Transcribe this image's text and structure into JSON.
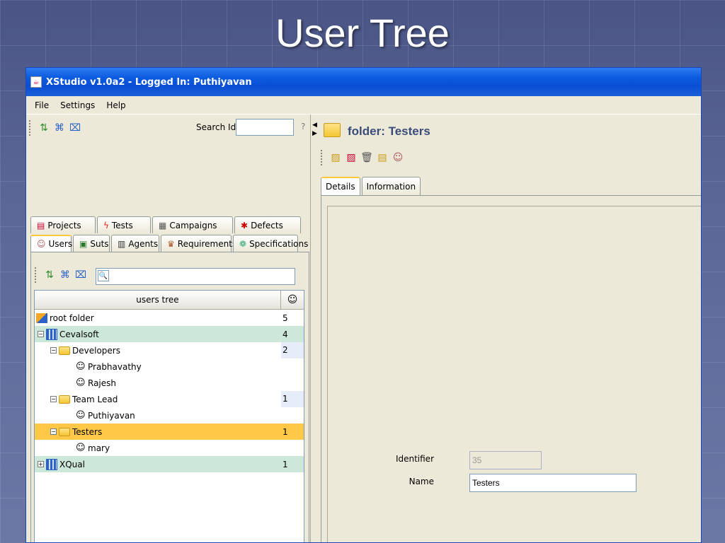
{
  "slide_title": "User Tree",
  "window": {
    "title": "XStudio v1.0a2 - Logged In: Puthiyavan"
  },
  "menu": [
    "File",
    "Settings",
    "Help"
  ],
  "search": {
    "label": "Search Id:",
    "value": "",
    "help": "?"
  },
  "tabs_row1": [
    {
      "label": "Projects",
      "icon": "projects-icon"
    },
    {
      "label": "Tests",
      "icon": "tests-icon"
    },
    {
      "label": "Campaigns",
      "icon": "campaigns-icon"
    },
    {
      "label": "Defects",
      "icon": "defects-icon"
    }
  ],
  "tabs_row2": [
    {
      "label": "Users",
      "icon": "users-icon",
      "active": true
    },
    {
      "label": "Suts",
      "icon": "suts-icon"
    },
    {
      "label": "Agents",
      "icon": "agents-icon"
    },
    {
      "label": "Requirements",
      "icon": "requirements-icon"
    },
    {
      "label": "Specifications",
      "icon": "specifications-icon"
    }
  ],
  "tree": {
    "header": "users tree",
    "rows": [
      {
        "label": "root folder",
        "count": "5",
        "type": "root",
        "indent": 0
      },
      {
        "label": "Cevalsoft",
        "count": "4",
        "type": "company",
        "indent": 0
      },
      {
        "label": "Developers",
        "count": "2",
        "type": "folder",
        "indent": 1
      },
      {
        "label": "Prabhavathy",
        "count": "",
        "type": "user",
        "indent": 2
      },
      {
        "label": "Rajesh",
        "count": "",
        "type": "user",
        "indent": 2
      },
      {
        "label": "Team Lead",
        "count": "1",
        "type": "folder",
        "indent": 1
      },
      {
        "label": "Puthiyavan",
        "count": "",
        "type": "user",
        "indent": 2
      },
      {
        "label": "Testers",
        "count": "1",
        "type": "folder",
        "indent": 1
      },
      {
        "label": "mary",
        "count": "",
        "type": "user",
        "indent": 2
      },
      {
        "label": "XQual",
        "count": "1",
        "type": "company",
        "indent": 0
      }
    ]
  },
  "right_panel": {
    "title": "folder: Testers",
    "tabs": [
      "Details",
      "Information"
    ],
    "fields": {
      "identifier_label": "Identifier",
      "identifier_value": "35",
      "name_label": "Name",
      "name_value": "Testers"
    }
  }
}
